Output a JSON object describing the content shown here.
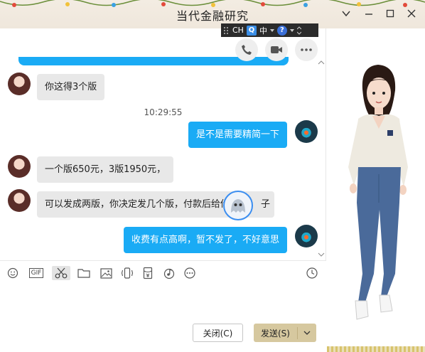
{
  "window": {
    "title": "当代金融研究",
    "controls": {
      "collapse_icon": "chevron-down-icon",
      "minimize_icon": "minimize-icon",
      "maximize_icon": "maximize-icon",
      "close_icon": "close-icon"
    }
  },
  "ime_bar": {
    "ch": "CH",
    "mode": "中",
    "help": "?"
  },
  "quick_actions": [
    "phone-icon",
    "video-icon",
    "more-icon"
  ],
  "messages": [
    {
      "side": "left",
      "text": "你这得3个版"
    },
    {
      "side": "time",
      "text": "10:29:55"
    },
    {
      "side": "right",
      "text": "是不是需要精简一下"
    },
    {
      "side": "left",
      "text": "一个版650元，3版1950元，"
    },
    {
      "side": "left",
      "text": "可以发成两版，你决定发几个版，付款后给你"
    },
    {
      "side": "left_tail",
      "text": "子"
    },
    {
      "side": "right",
      "text": "收费有点高啊，暂不发了，不好意思"
    }
  ],
  "toolbar": {
    "gif_label": "GIF",
    "items": [
      "emoji-icon",
      "gif-icon",
      "scissors-icon",
      "folder-icon",
      "image-icon",
      "shake-icon",
      "red-packet-icon",
      "music-icon",
      "more-icon",
      "history-icon"
    ]
  },
  "actions": {
    "close_label": "关闭(C)",
    "send_label": "发送(S)"
  },
  "colors": {
    "accent": "#1aabf5",
    "send_button": "#d6c89f",
    "titlebar": "#f0e8dd"
  }
}
